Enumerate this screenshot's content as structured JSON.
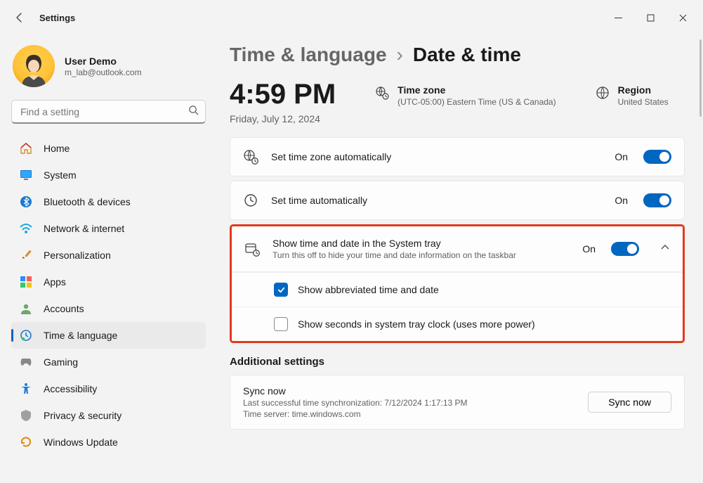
{
  "window": {
    "title": "Settings"
  },
  "user": {
    "name": "User Demo",
    "email": "m_lab@outlook.com"
  },
  "search": {
    "placeholder": "Find a setting"
  },
  "nav": [
    {
      "id": "home",
      "label": "Home"
    },
    {
      "id": "system",
      "label": "System"
    },
    {
      "id": "bluetooth",
      "label": "Bluetooth & devices"
    },
    {
      "id": "network",
      "label": "Network & internet"
    },
    {
      "id": "personalization",
      "label": "Personalization"
    },
    {
      "id": "apps",
      "label": "Apps"
    },
    {
      "id": "accounts",
      "label": "Accounts"
    },
    {
      "id": "time",
      "label": "Time & language",
      "selected": true
    },
    {
      "id": "gaming",
      "label": "Gaming"
    },
    {
      "id": "accessibility",
      "label": "Accessibility"
    },
    {
      "id": "privacy",
      "label": "Privacy & security"
    },
    {
      "id": "update",
      "label": "Windows Update"
    }
  ],
  "breadcrumb": {
    "parent": "Time & language",
    "current": "Date & time"
  },
  "clock": {
    "time": "4:59 PM",
    "date": "Friday, July 12, 2024"
  },
  "timezone": {
    "title": "Time zone",
    "value": "(UTC-05:00) Eastern Time (US & Canada)"
  },
  "region": {
    "title": "Region",
    "value": "United States"
  },
  "rows": {
    "tz_auto": {
      "label": "Set time zone automatically",
      "state": "On"
    },
    "time_auto": {
      "label": "Set time automatically",
      "state": "On"
    },
    "systray": {
      "label": "Show time and date in the System tray",
      "sub": "Turn this off to hide your time and date information on the taskbar",
      "state": "On"
    },
    "abbrev": {
      "label": "Show abbreviated time and date"
    },
    "seconds": {
      "label": "Show seconds in system tray clock (uses more power)"
    }
  },
  "additional": {
    "heading": "Additional settings",
    "sync": {
      "title": "Sync now",
      "last": "Last successful time synchronization: 7/12/2024 1:17:13 PM",
      "server": "Time server: time.windows.com",
      "button": "Sync now"
    }
  }
}
